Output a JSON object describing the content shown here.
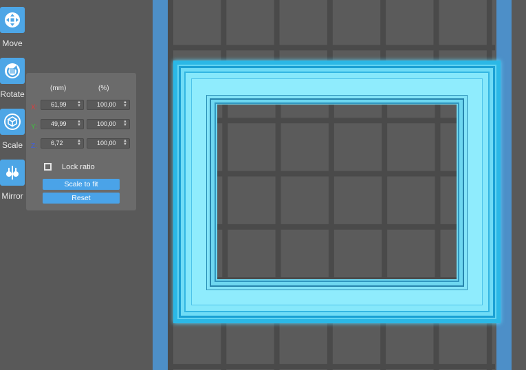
{
  "toolbar": {
    "move_label": "Move",
    "rotate_label": "Rotate",
    "scale_label": "Scale",
    "mirror_label": "Mirror",
    "icons": [
      "move-icon",
      "rotate-icon",
      "scale-icon",
      "mirror-icon"
    ],
    "active_tool": "Scale"
  },
  "scale_panel": {
    "col_mm": "(mm)",
    "col_pct": "(%)",
    "rows": [
      {
        "axis": "X:",
        "axis_color": "#e23b3b",
        "mm": "61,99",
        "pct": "100,00"
      },
      {
        "axis": "Y:",
        "axis_color": "#3fbf3f",
        "mm": "49,99",
        "pct": "100,00"
      },
      {
        "axis": "Z:",
        "axis_color": "#3f5fe0",
        "mm": "6,72",
        "pct": "100,00"
      }
    ],
    "lock_ratio_label": "Lock ratio",
    "lock_ratio_checked": false,
    "scale_to_fit_label": "Scale to fit",
    "reset_label": "Reset"
  },
  "colors": {
    "accent": "#4da6e6",
    "model": "#62d4f2",
    "plate_edge": "#4d8fc8"
  }
}
